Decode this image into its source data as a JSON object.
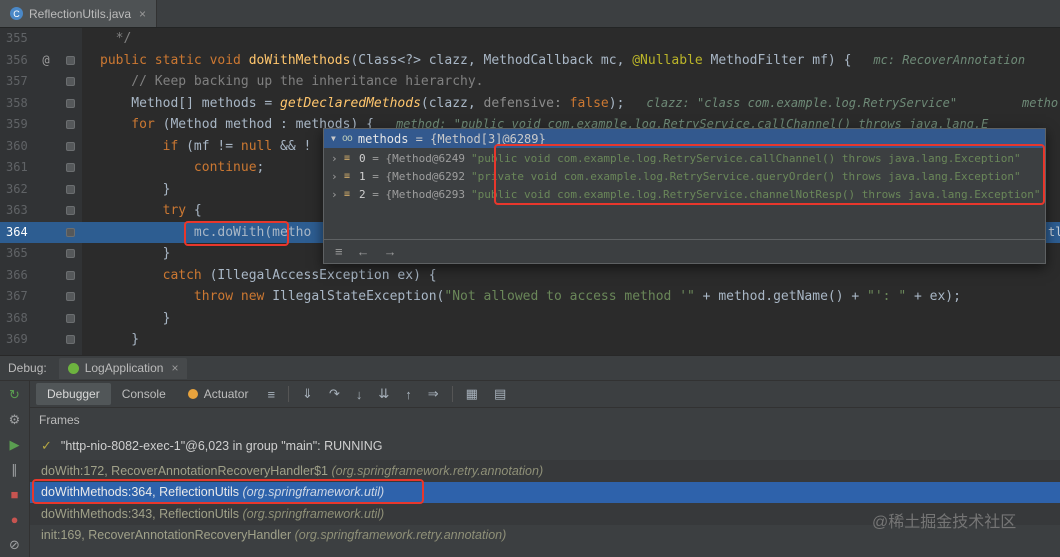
{
  "tabbar": {
    "file_tab": {
      "icon": "java-class-icon",
      "icon_letter": "C",
      "label": "ReflectionUtils.java",
      "close": "×"
    }
  },
  "editor": {
    "lines": [
      {
        "num": "355",
        "mark": false,
        "segs": [
          [
            "cmt",
            "  */"
          ]
        ]
      },
      {
        "num": "356",
        "gutter": "@",
        "mark": true,
        "segs": [
          [
            "kw",
            "public static void "
          ],
          [
            "fn",
            "doWithMethods"
          ],
          [
            "pl",
            "(Class<?> clazz, MethodCallback mc, "
          ],
          [
            "ann",
            "@Nullable"
          ],
          [
            "pl",
            " MethodFilter mf) {"
          ]
        ],
        "hints": [
          {
            "text": "mc: RecoverAnnotation"
          }
        ]
      },
      {
        "num": "357",
        "mark": true,
        "segs": [
          [
            "cmt",
            "    // Keep backing up the inheritance hierarchy."
          ]
        ]
      },
      {
        "num": "358",
        "mark": true,
        "segs": [
          [
            "pl",
            "    Method[] methods = "
          ],
          [
            "fni",
            "getDeclaredMethods"
          ],
          [
            "pl",
            "(clazz, "
          ],
          [
            "ph",
            "defensive: "
          ],
          [
            "kw",
            "false"
          ],
          [
            "pl",
            ");"
          ]
        ],
        "hints": [
          {
            "text": "clazz: \"class com.example.log.RetryService\""
          },
          {
            "text": "metho",
            "abs": true
          }
        ]
      },
      {
        "num": "359",
        "mark": true,
        "segs": [
          [
            "kw",
            "    for"
          ],
          [
            "pl",
            " (Method method : methods) {"
          ]
        ],
        "hints": [
          {
            "text": "method: \"public void com.example.log.RetryService.callChannel() throws java.lang.E"
          }
        ]
      },
      {
        "num": "360",
        "mark": true,
        "segs": [
          [
            "kw",
            "        if"
          ],
          [
            "pl",
            " (mf != "
          ],
          [
            "kw",
            "null"
          ],
          [
            "pl",
            " && !"
          ]
        ]
      },
      {
        "num": "361",
        "mark": true,
        "segs": [
          [
            "kw",
            "            continue"
          ],
          [
            "pl",
            ";"
          ]
        ]
      },
      {
        "num": "362",
        "mark": true,
        "segs": [
          [
            "pl",
            "        }"
          ]
        ]
      },
      {
        "num": "363",
        "mark": true,
        "segs": [
          [
            "kw",
            "        try"
          ],
          [
            "pl",
            " {"
          ]
        ]
      },
      {
        "num": "364",
        "mark": true,
        "current": true,
        "segs": [
          [
            "pl",
            "            mc.doWith(metho"
          ]
        ],
        "hints": [
          {
            "text": "tl",
            "abs": true
          }
        ]
      },
      {
        "num": "365",
        "mark": true,
        "segs": [
          [
            "pl",
            "        }"
          ]
        ]
      },
      {
        "num": "366",
        "mark": true,
        "segs": [
          [
            "kw",
            "        catch"
          ],
          [
            "pl",
            " (IllegalAccessException ex) {"
          ]
        ]
      },
      {
        "num": "367",
        "mark": true,
        "segs": [
          [
            "kw",
            "            throw new"
          ],
          [
            "pl",
            " IllegalStateException("
          ],
          [
            "str",
            "\"Not allowed to access method '\""
          ],
          [
            "pl",
            " + method.getName() + "
          ],
          [
            "str",
            "\"': \""
          ],
          [
            "pl",
            " + ex);"
          ]
        ]
      },
      {
        "num": "368",
        "mark": true,
        "segs": [
          [
            "pl",
            "        }"
          ]
        ]
      },
      {
        "num": "369",
        "mark": true,
        "segs": [
          [
            "pl",
            "    }"
          ]
        ]
      }
    ]
  },
  "popup": {
    "header": {
      "expander": "▼",
      "watch_glyph": "oo",
      "name": "methods",
      "eq": " = ",
      "ref": "{Method[3]@6289}"
    },
    "rows": [
      {
        "chevron": "›",
        "index": "0",
        "eq": " = ",
        "ref": "{Method@6249",
        "value": "\"public void com.example.log.RetryService.callChannel() throws java.lang.Exception\""
      },
      {
        "chevron": "›",
        "index": "1",
        "eq": " = ",
        "ref": "{Method@6292",
        "value": "\"private void com.example.log.RetryService.queryOrder() throws java.lang.Exception\""
      },
      {
        "chevron": "›",
        "index": "2",
        "eq": " = ",
        "ref": "{Method@6293",
        "value": "\"public void com.example.log.RetryService.channelNotResp() throws java.lang.Exception\""
      }
    ],
    "footer": {
      "icons": [
        {
          "name": "keyboard-shortcut-icon",
          "glyph": "≡"
        },
        {
          "name": "back-icon",
          "glyph": "←"
        },
        {
          "name": "forward-icon",
          "glyph": "→"
        }
      ]
    }
  },
  "debug": {
    "label": "Debug:",
    "session_tab": {
      "label": "LogApplication",
      "close": "×"
    },
    "tabs": [
      {
        "label": "Debugger",
        "selected": true,
        "icon": false
      },
      {
        "label": "Console",
        "selected": false,
        "icon": false
      },
      {
        "label": "Actuator",
        "selected": false,
        "icon": true
      }
    ],
    "toolbar_icons": [
      {
        "name": "hamburger-menu-icon",
        "glyph": "≡"
      },
      {
        "name": "show-execution-point-icon",
        "glyph": "⇓"
      },
      {
        "name": "step-over-icon",
        "glyph": "↷"
      },
      {
        "name": "step-into-icon",
        "glyph": "↓"
      },
      {
        "name": "force-step-into-icon",
        "glyph": "⇊"
      },
      {
        "name": "step-out-icon",
        "glyph": "↑"
      },
      {
        "name": "run-to-cursor-icon",
        "glyph": "⇒"
      },
      {
        "name": "view-as-table-icon",
        "glyph": "▦"
      },
      {
        "name": "layout-settings-icon",
        "glyph": "▤"
      }
    ],
    "left_toolbar": [
      {
        "name": "rerun-icon",
        "glyph": "↻",
        "color": "#5a9e50"
      },
      {
        "name": "settings-icon",
        "glyph": "⚙",
        "color": "#9fa1a3"
      },
      {
        "name": "resume-icon",
        "glyph": "▶",
        "color": "#5a9e50"
      },
      {
        "name": "pause-icon",
        "glyph": "∥",
        "color": "#9fa1a3"
      },
      {
        "name": "stop-icon",
        "glyph": "■",
        "color": "#c75450"
      },
      {
        "name": "view-breakpoints-icon",
        "glyph": "●",
        "color": "#c75450"
      },
      {
        "name": "mute-breakpoints-icon",
        "glyph": "⊘",
        "color": "#9fa1a3"
      }
    ],
    "frames": {
      "title": "Frames",
      "thread": {
        "check": "✓",
        "label": "\"http-nio-8082-exec-1\"@6,023 in group \"main\": RUNNING"
      },
      "rows": [
        {
          "text": "doWith:172, RecoverAnnotationRecoveryHandler$1 ",
          "pkg": "(org.springframework.retry.annotation)",
          "selected": false
        },
        {
          "text": "doWithMethods:364, ReflectionUtils ",
          "pkg": "(org.springframework.util)",
          "selected": true
        },
        {
          "text": "doWithMethods:343, ReflectionUtils ",
          "pkg": "(org.springframework.util)",
          "selected": false
        },
        {
          "text": "init:169, RecoverAnnotationRecoveryHandler ",
          "pkg": "(org.springframework.retry.annotation)",
          "selected": false
        }
      ]
    }
  },
  "watermark": "@稀土掘金技术社区"
}
